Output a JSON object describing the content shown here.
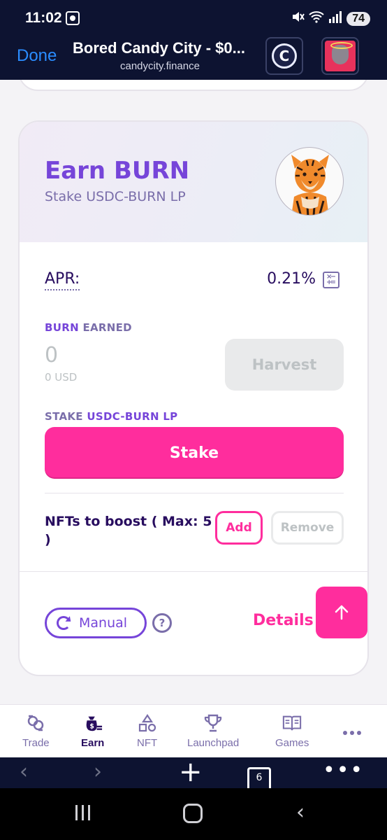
{
  "status_bar": {
    "time": "11:02",
    "battery": "74"
  },
  "browser": {
    "done_label": "Done",
    "title": "Bored Candy City - $0...",
    "url": "candycity.finance",
    "tab_count": "6"
  },
  "pool": {
    "title": "Earn BURN",
    "subtitle": "Stake USDC-BURN LP",
    "apr_label": "APR:",
    "apr_value": "0.21%",
    "earned_token": "BURN",
    "earned_suffix": " EARNED",
    "earned_amount": "0",
    "earned_usd": "0 USD",
    "harvest_label": "Harvest",
    "stake_prefix": "STAKE ",
    "stake_token": "USDC-BURN LP",
    "stake_button": "Stake",
    "boost_text": "NFTs to boost ( Max: 5 )",
    "add_label": "Add",
    "remove_label": "Remove",
    "manual_label": "Manual",
    "help_glyph": "?",
    "details_label": "Details"
  },
  "app_nav": {
    "items": [
      {
        "label": "Trade",
        "icon": "trade-icon"
      },
      {
        "label": "Earn",
        "icon": "earn-icon",
        "active": true
      },
      {
        "label": "NFT",
        "icon": "nft-icon"
      },
      {
        "label": "Launchpad",
        "icon": "trophy-icon"
      },
      {
        "label": "Games",
        "icon": "book-icon"
      },
      {
        "label": "",
        "icon": "more-icon"
      }
    ]
  },
  "colors": {
    "primary_purple": "#7645d9",
    "text_dark": "#280d5f",
    "pink": "#ff2d9d",
    "browser_bg": "#0d1331"
  }
}
